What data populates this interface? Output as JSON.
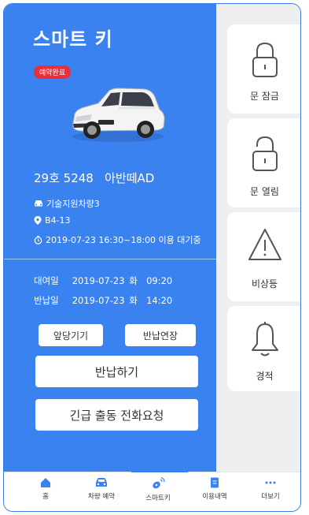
{
  "header": {
    "title": "스마트 키",
    "badge": "예약완료"
  },
  "car": {
    "plate_model": "29호 5248   아반떼AD"
  },
  "info": {
    "car_name": "기술지원차량3",
    "location": "B4-13",
    "time": "2019-07-23 16:30~18:00 이용 대기중"
  },
  "rental": {
    "rent_label": "대여일",
    "rent_date": "2019-07-23 화  09:20",
    "return_label": "반납일",
    "return_date": "2019-07-23 화  14:20"
  },
  "buttons": {
    "advance": "앞당기기",
    "extend": "반납연장",
    "return": "반납하기",
    "emergency": "긴급 출동 전화요청"
  },
  "controls": [
    {
      "label": "문 잠금",
      "icon": "lock-closed-icon"
    },
    {
      "label": "문 열림",
      "icon": "lock-open-icon"
    },
    {
      "label": "비상등",
      "icon": "warning-triangle-icon"
    },
    {
      "label": "경적",
      "icon": "bell-icon"
    }
  ],
  "nav": [
    {
      "label": "홈",
      "icon": "home-icon"
    },
    {
      "label": "차량 예약",
      "icon": "car-icon"
    },
    {
      "label": "스마트키",
      "icon": "smart-key-icon"
    },
    {
      "label": "이용내역",
      "icon": "document-icon"
    },
    {
      "label": "더보기",
      "icon": "more-icon"
    }
  ],
  "colors": {
    "primary": "#3a82ef",
    "badge": "#e8303a",
    "background": "#efefef"
  }
}
